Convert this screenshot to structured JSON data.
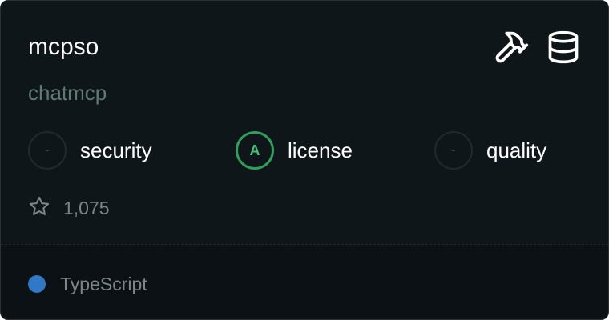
{
  "card": {
    "name": "mcpso",
    "owner": "chatmcp",
    "icons": [
      "hammer-icon",
      "database-icon"
    ],
    "scores": [
      {
        "grade": "-",
        "label": "security"
      },
      {
        "grade": "A",
        "label": "license"
      },
      {
        "grade": "-",
        "label": "quality"
      }
    ],
    "stars": "1,075",
    "language": {
      "name": "TypeScript",
      "color": "#3178c6"
    }
  },
  "colors": {
    "background": "#0f1619",
    "footer": "#0b1114",
    "owner_text": "#5f7a74",
    "grade_a": "#2f9f5d"
  }
}
